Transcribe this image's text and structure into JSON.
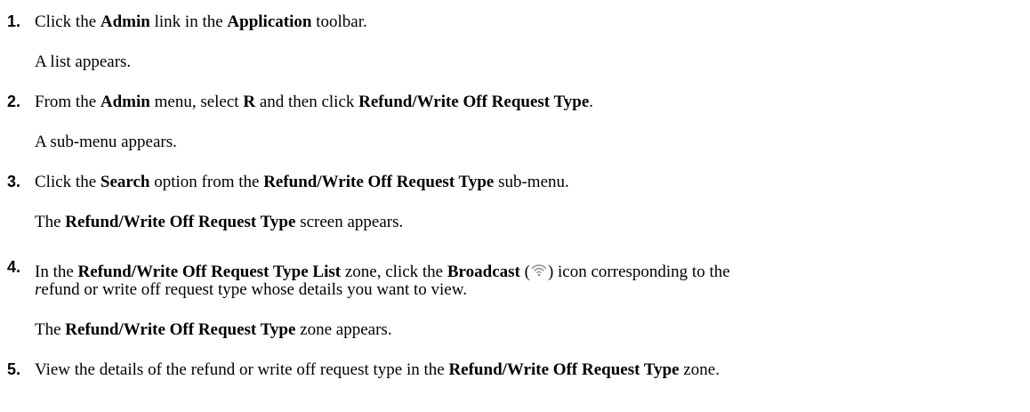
{
  "steps": [
    {
      "number": "1.",
      "text": {
        "a": "Click the ",
        "b1": "Admin",
        "c": " link in the ",
        "b2": "Application",
        "d": " toolbar."
      },
      "result": "A list appears."
    },
    {
      "number": "2.",
      "text": {
        "a": "From the ",
        "b1": "Admin",
        "c": " menu, select ",
        "b2": "R",
        "d": " and then click ",
        "b3": "Refund/Write Off Request Type",
        "e": "."
      },
      "result": "A sub-menu appears."
    },
    {
      "number": "3.",
      "text": {
        "a": "Click the ",
        "b1": "Search",
        "c": " option from the ",
        "b2": "Refund/Write Off Request Type",
        "d": " sub-menu."
      },
      "result": {
        "a": "The ",
        "b1": "Refund/Write Off Request Type",
        "c": " screen appears."
      }
    },
    {
      "number": "4.",
      "text": {
        "a": "In the ",
        "b1": "Refund/Write Off Request Type List",
        "c": " zone, click the ",
        "b2": "Broadcast",
        "d": " (",
        "icon": "broadcast-icon",
        "e": ") icon corresponding to the",
        "line2_i": "r",
        "line2": "efund or write off request type whose details you want to view."
      },
      "result": {
        "a": "The ",
        "b1": "Refund/Write Off Request Type",
        "c": " zone appears."
      }
    },
    {
      "number": "5.",
      "text": {
        "a": "View the details of the refund or write off request type in the ",
        "b1": "Refund/Write Off Request Type",
        "c": " zone."
      }
    }
  ]
}
